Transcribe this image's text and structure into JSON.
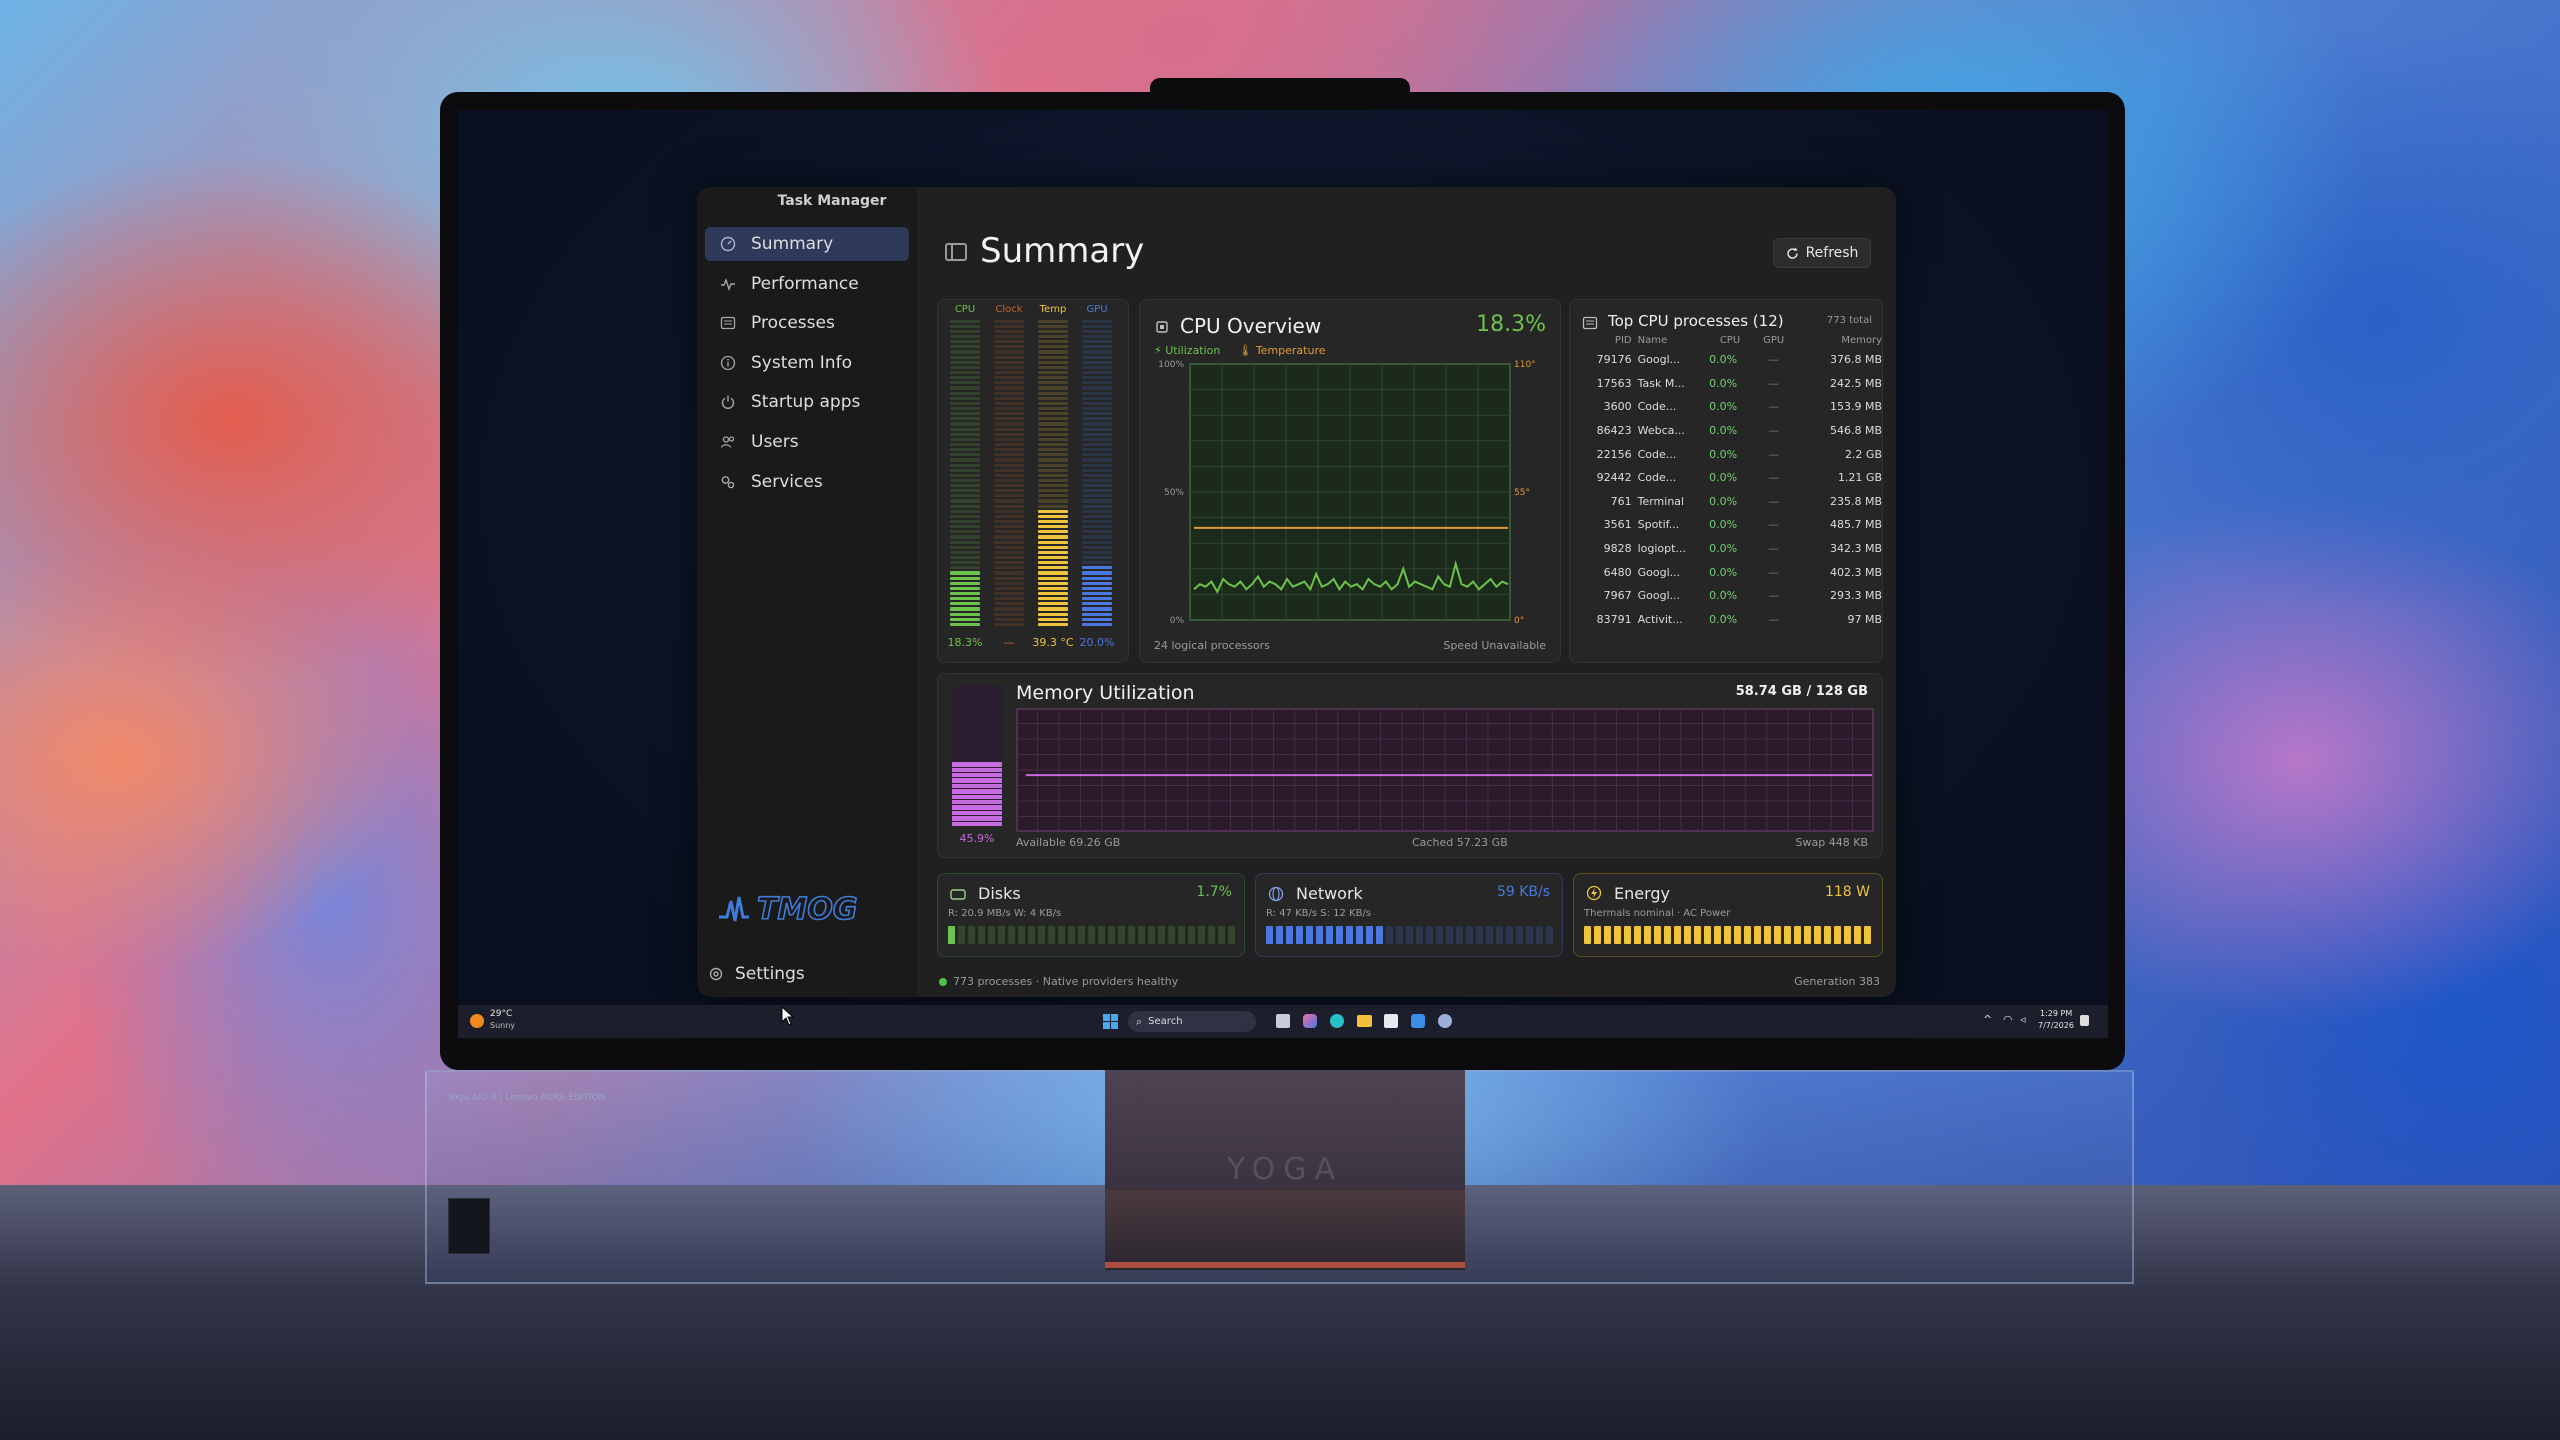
{
  "app": {
    "title": "Task Manager"
  },
  "sidebar": {
    "items": [
      {
        "label": "Summary",
        "icon": "gauge-icon",
        "active": true
      },
      {
        "label": "Performance",
        "icon": "pulse-icon"
      },
      {
        "label": "Processes",
        "icon": "list-icon"
      },
      {
        "label": "System Info",
        "icon": "info-icon"
      },
      {
        "label": "Startup apps",
        "icon": "power-icon"
      },
      {
        "label": "Users",
        "icon": "users-icon"
      },
      {
        "label": "Services",
        "icon": "gears-icon"
      }
    ],
    "brand": "TMOG",
    "settings_label": "Settings"
  },
  "header": {
    "title": "Summary",
    "refresh_label": "Refresh"
  },
  "gauges": {
    "labels": [
      "CPU",
      "Clock",
      "Temp",
      "GPU"
    ],
    "values": [
      "18.3%",
      "—",
      "39.3 °C",
      "20.0%"
    ],
    "fill": [
      0.183,
      0.0,
      0.39,
      0.2
    ],
    "colors": [
      "#6cc24a",
      "#c0662c",
      "#f0c43a",
      "#4a78e0"
    ]
  },
  "cpu_overview": {
    "title": "CPU Overview",
    "value": "18.3%",
    "legend_utilization": "Utilization",
    "legend_temperature": "Temperature",
    "y_left_top": "100%",
    "y_left_mid": "50%",
    "y_left_bottom": "0%",
    "y_right_top": "110°",
    "y_right_mid": "55°",
    "y_right_bottom": "0°",
    "footer_left": "24 logical processors",
    "footer_right": "Speed Unavailable",
    "accent": "#6cc24a",
    "temp_color": "#e09a3a",
    "temp_level": 0.36,
    "util_series": [
      12,
      14,
      13,
      15,
      11,
      16,
      14,
      13,
      15,
      12,
      14,
      17,
      13,
      15,
      14,
      12,
      16,
      13,
      14,
      15,
      12,
      18,
      13,
      14,
      16,
      12,
      15,
      13,
      14,
      12,
      16,
      14,
      13,
      15,
      12,
      14,
      20,
      13,
      15,
      14,
      13,
      12,
      17,
      14,
      13,
      22,
      14,
      13,
      15,
      12,
      14,
      16,
      13,
      15,
      14
    ]
  },
  "top_processes": {
    "title": "Top CPU processes (12)",
    "total": "773 total",
    "columns": [
      "PID",
      "Name",
      "CPU",
      "GPU",
      "Memory"
    ],
    "rows": [
      {
        "pid": "79176",
        "name": "Googl...",
        "cpu": "0.0%",
        "gpu": "—",
        "mem": "376.8 MB"
      },
      {
        "pid": "17563",
        "name": "Task M...",
        "cpu": "0.0%",
        "gpu": "—",
        "mem": "242.5 MB"
      },
      {
        "pid": "3600",
        "name": "Code...",
        "cpu": "0.0%",
        "gpu": "—",
        "mem": "153.9 MB"
      },
      {
        "pid": "86423",
        "name": "Webca...",
        "cpu": "0.0%",
        "gpu": "—",
        "mem": "546.8 MB"
      },
      {
        "pid": "22156",
        "name": "Code...",
        "cpu": "0.0%",
        "gpu": "—",
        "mem": "2.2 GB"
      },
      {
        "pid": "92442",
        "name": "Code...",
        "cpu": "0.0%",
        "gpu": "—",
        "mem": "1.21 GB"
      },
      {
        "pid": "761",
        "name": "Terminal",
        "cpu": "0.0%",
        "gpu": "—",
        "mem": "235.8 MB"
      },
      {
        "pid": "3561",
        "name": "Spotif...",
        "cpu": "0.0%",
        "gpu": "—",
        "mem": "485.7 MB"
      },
      {
        "pid": "9828",
        "name": "logiopt...",
        "cpu": "0.0%",
        "gpu": "—",
        "mem": "342.3 MB"
      },
      {
        "pid": "6480",
        "name": "Googl...",
        "cpu": "0.0%",
        "gpu": "—",
        "mem": "402.3 MB"
      },
      {
        "pid": "7967",
        "name": "Googl...",
        "cpu": "0.0%",
        "gpu": "—",
        "mem": "293.3 MB"
      },
      {
        "pid": "83791",
        "name": "Activit...",
        "cpu": "0.0%",
        "gpu": "—",
        "mem": "97 MB"
      }
    ]
  },
  "memory": {
    "title": "Memory Utilization",
    "usage": "58.74 GB / 128 GB",
    "percent": "45.9%",
    "fill": 0.459,
    "available": "Available 69.26 GB",
    "cached": "Cached 57.23 GB",
    "swap": "Swap 448 KB",
    "accent": "#c86ae0"
  },
  "disks": {
    "title": "Disks",
    "value": "1.7%",
    "detail": "R: 20.9 MB/s  W: 4 KB/s",
    "fill": 0.02,
    "accent": "#6cc24a"
  },
  "network": {
    "title": "Network",
    "value": "59 KB/s",
    "detail": "R: 47 KB/s  S: 12 KB/s",
    "fill": 0.4,
    "accent": "#4a78e0"
  },
  "energy": {
    "title": "Energy",
    "value": "118 W",
    "detail": "Thermals nominal · AC Power",
    "fill": 1.0,
    "accent": "#f0c43a"
  },
  "status": {
    "left": "773 processes · Native providers healthy",
    "right": "Generation 383"
  },
  "taskbar": {
    "weather_temp": "29°C",
    "weather_desc": "Sunny",
    "search_placeholder": "Search",
    "time": "1:29 PM",
    "date": "7/7/2026"
  },
  "stand_logo": "YOGA",
  "base_label": "Yoga AIO 9 | Lenovo AURA EDITION"
}
